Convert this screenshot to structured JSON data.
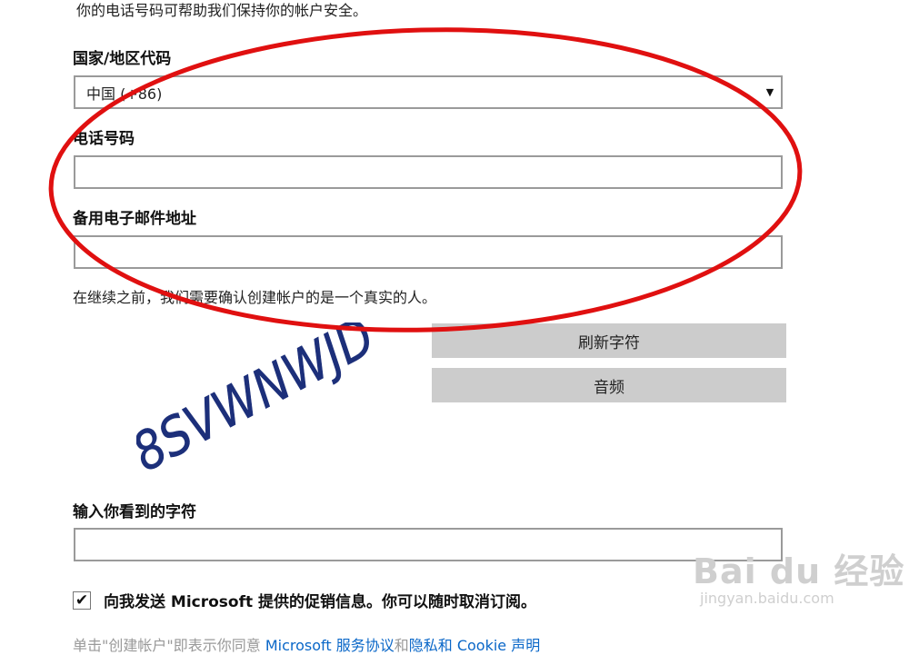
{
  "intro_text": "你的电话号码可帮助我们保持你的帐户安全。",
  "country": {
    "label": "国家/地区代码",
    "selected": "中国 (+86)"
  },
  "phone": {
    "label": "电话号码",
    "value": ""
  },
  "backup_email": {
    "label": "备用电子邮件地址",
    "value": ""
  },
  "verify_note": "在继续之前，我们需要确认创建帐户的是一个真实的人。",
  "captcha": {
    "text": "8SVWNWJD",
    "refresh_label": "刷新字符",
    "audio_label": "音频"
  },
  "captcha_input": {
    "label": "输入你看到的字符",
    "value": ""
  },
  "promo": {
    "checked": true,
    "check_glyph": "✔",
    "label": "向我发送 Microsoft 提供的促销信息。你可以随时取消订阅。"
  },
  "footer_partial": {
    "prefix": "单击\"创建帐户\"即表示你同意 ",
    "link1": "Microsoft 服务协议",
    "middle": "和",
    "link2": "隐私和 Cookie 声明"
  },
  "watermark": {
    "brand": "Bai du 经验",
    "url": "jingyan.baidu.com"
  },
  "colors": {
    "annotation_ellipse": "#e01010",
    "button_bg": "#cccccc",
    "link": "#0a67c8",
    "captcha_ink": "#1c2f7a"
  }
}
